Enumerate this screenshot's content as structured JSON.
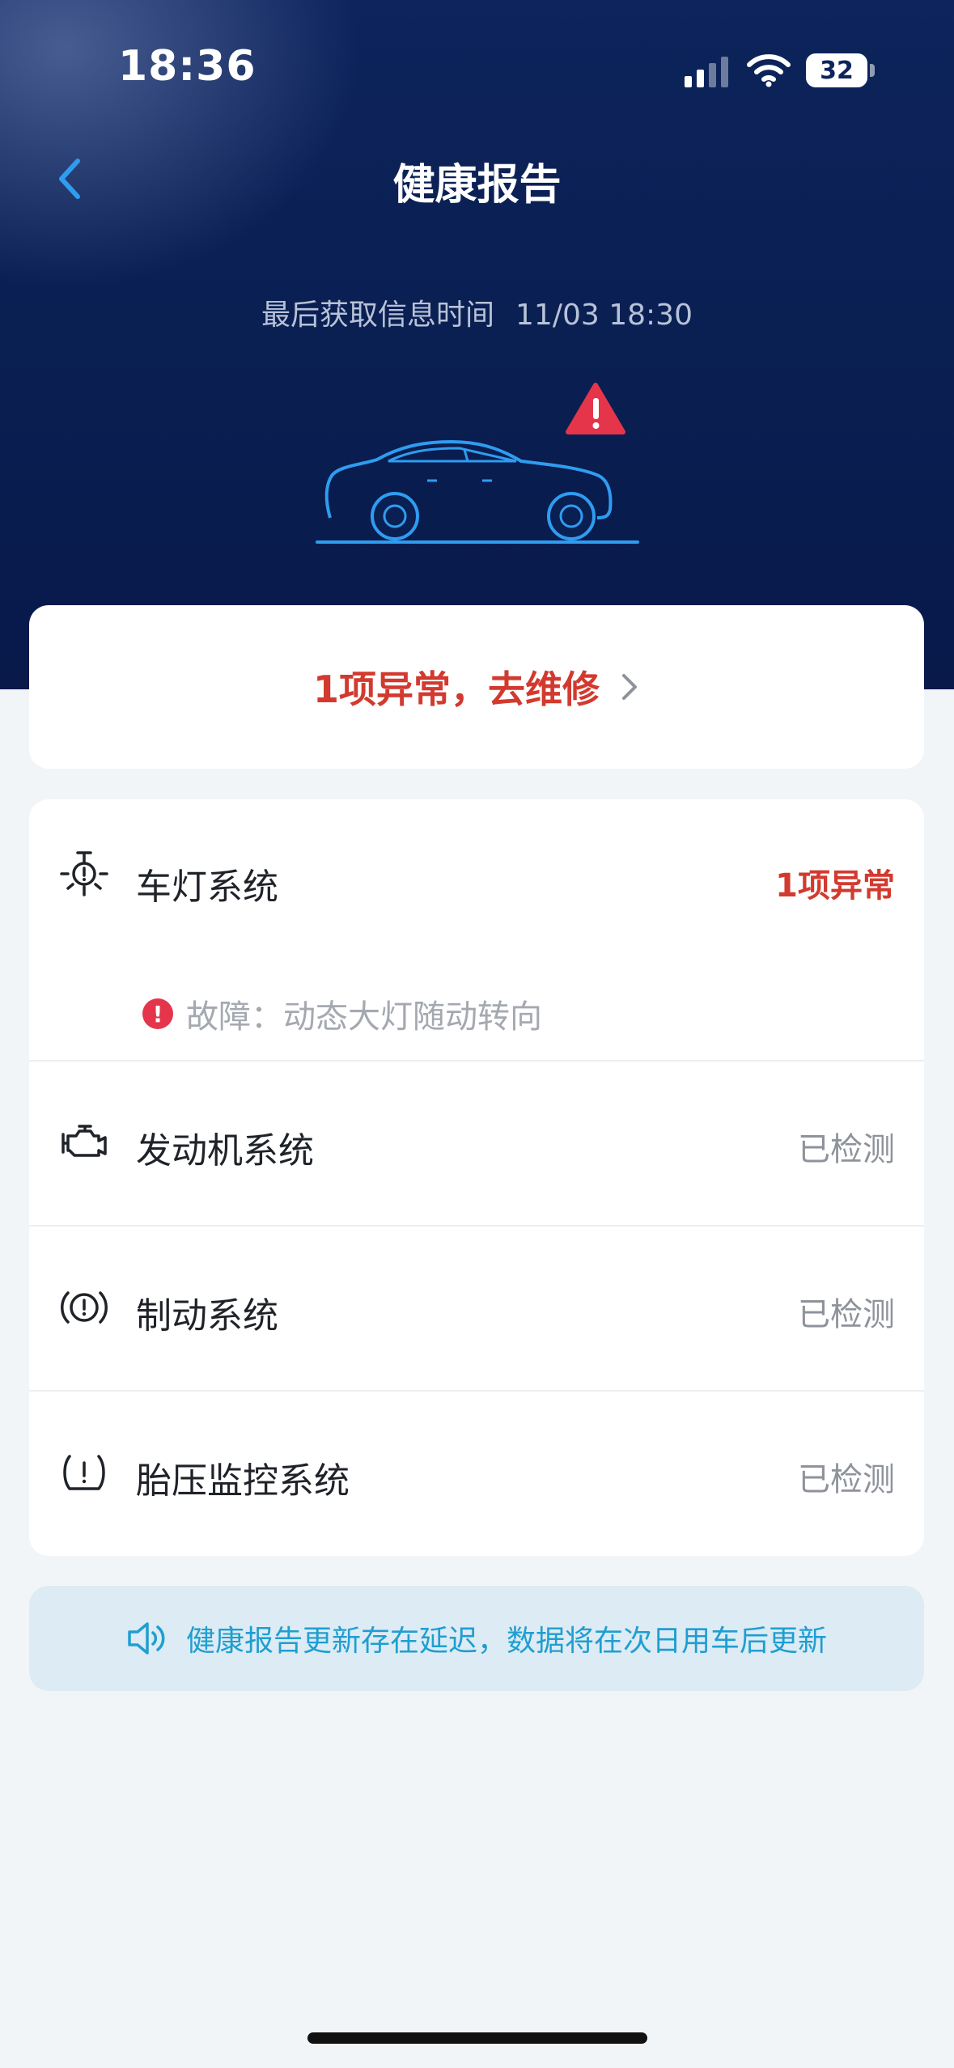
{
  "status_bar": {
    "time": "18:36",
    "battery": "32"
  },
  "nav": {
    "title": "健康报告",
    "back_icon": "chevron-left-icon"
  },
  "info": {
    "last_fetch_label": "最后获取信息时间",
    "last_fetch_time": "11/03 18:30"
  },
  "summary": {
    "repair_text": "1项异常，去维修"
  },
  "systems": [
    {
      "name": "车灯系统",
      "status": "1项异常",
      "alert": true,
      "icon": "headlight-icon",
      "fault_text": "故障：动态大灯随动转向"
    },
    {
      "name": "发动机系统",
      "status": "已检测",
      "alert": false,
      "icon": "engine-icon"
    },
    {
      "name": "制动系统",
      "status": "已检测",
      "alert": false,
      "icon": "brake-icon"
    },
    {
      "name": "胎压监控系统",
      "status": "已检测",
      "alert": false,
      "icon": "tire-pressure-icon"
    }
  ],
  "notice": {
    "text": "健康报告更新存在延迟，数据将在次日用车后更新",
    "icon": "speaker-icon"
  },
  "colors": {
    "hero_bg": "#0a1f52",
    "alert_red": "#d23a2f",
    "accent_blue": "#1f9ed1",
    "car_outline": "#2f9cf0",
    "warning_triangle": "#e5354b"
  }
}
